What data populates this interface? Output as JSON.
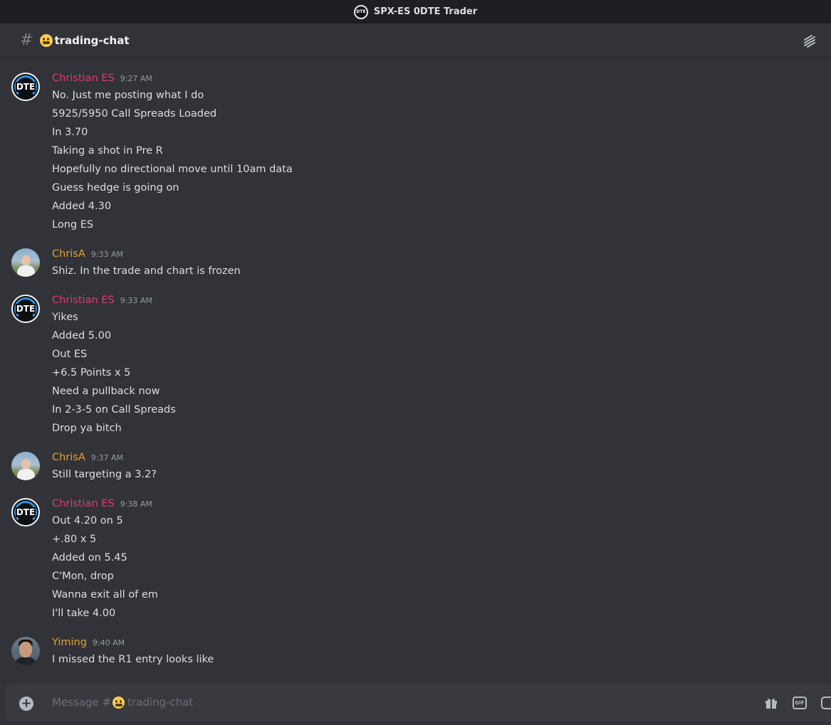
{
  "window": {
    "title": "SPX-ES 0DTE Trader",
    "logo_text": "DTE"
  },
  "channel": {
    "name": "trading-chat"
  },
  "messages": [
    {
      "author": "Christian ES",
      "time": "9:27 AM",
      "color": "#e03a6e",
      "avatar": "dte-logo",
      "lines": [
        "No. Just me posting what I do",
        "5925/5950 Call Spreads Loaded",
        "In 3.70",
        "Taking a shot in Pre R",
        "Hopefully no directional move until 10am data",
        "Guess hedge is going on",
        "Added 4.30",
        "Long ES"
      ]
    },
    {
      "author": "ChrisA",
      "time": "9:33 AM",
      "color": "#e6a02e",
      "avatar": "user-photo",
      "lines": [
        "Shiz.  In the trade and chart is frozen"
      ]
    },
    {
      "author": "Christian ES",
      "time": "9:33 AM",
      "color": "#e03a6e",
      "avatar": "dte-logo",
      "lines": [
        "Yikes",
        "Added 5.00",
        "Out ES",
        "+6.5 Points x 5",
        "Need a pullback now",
        "In 2-3-5 on Call Spreads",
        "Drop ya bitch"
      ]
    },
    {
      "author": "ChrisA",
      "time": "9:37 AM",
      "color": "#e6a02e",
      "avatar": "user-photo",
      "lines": [
        "Still targeting a 3.2?"
      ]
    },
    {
      "author": "Christian ES",
      "time": "9:38 AM",
      "color": "#e03a6e",
      "avatar": "dte-logo",
      "lines": [
        "Out 4.20 on 5",
        "+.80 x 5",
        "Added on 5.45",
        "C'Mon, drop",
        "Wanna exit all of em",
        "I'll take 4.00"
      ]
    },
    {
      "author": "Yiming",
      "time": "9:40 AM",
      "color": "#e6a02e",
      "avatar": "user-photo",
      "lines": [
        "I missed the R1 entry looks like"
      ]
    }
  ],
  "composer": {
    "placeholder_prefix": "Message #",
    "placeholder_channel": "trading-chat",
    "gif_label": "GIF"
  }
}
